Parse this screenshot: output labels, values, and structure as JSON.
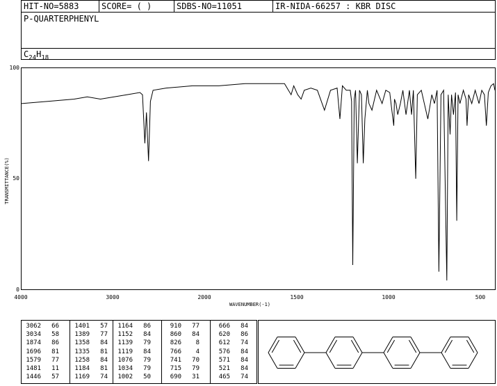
{
  "header": {
    "hit_no": "HIT-NO=5883",
    "score": "SCORE=  (  )",
    "sdbs_no": "SDBS-NO=11051",
    "ir_info": "IR-NIDA-66257 : KBR DISC",
    "compound": "P-QUARTERPHENYL",
    "formula_c": "C",
    "formula_c_n": "24",
    "formula_h": "H",
    "formula_h_n": "18"
  },
  "chart_data": {
    "type": "line",
    "xlabel": "WAVENUMBER(-1)",
    "ylabel": "TRANSMITTANCE(%)",
    "xlim": [
      4000,
      400
    ],
    "ylim": [
      0,
      100
    ],
    "x_ticks": [
      "4000",
      "3000",
      "2000",
      "1500",
      "1000",
      "500"
    ],
    "y_ticks": [
      "100",
      "50",
      "0"
    ],
    "grid": false,
    "series": [
      {
        "x": [
          4000,
          3800,
          3600,
          3500,
          3400,
          3200,
          3100,
          3080,
          3062,
          3050,
          3034,
          3020,
          3000,
          2900,
          2700,
          2500,
          2300,
          2100,
          2000,
          1950,
          1930,
          1900,
          1874,
          1850,
          1800,
          1750,
          1696,
          1650,
          1600,
          1579,
          1560,
          1530,
          1500,
          1490,
          1481,
          1470,
          1460,
          1446,
          1430,
          1415,
          1401,
          1389,
          1370,
          1358,
          1335,
          1300,
          1258,
          1230,
          1200,
          1184,
          1169,
          1164,
          1152,
          1139,
          1119,
          1100,
          1076,
          1050,
          1034,
          1020,
          1002,
          990,
          960,
          910,
          880,
          860,
          840,
          826,
          810,
          790,
          766,
          755,
          741,
          730,
          715,
          700,
          690,
          680,
          666,
          640,
          620,
          612,
          600,
          576,
          550,
          521,
          500,
          480,
          465,
          450,
          430,
          410,
          400
        ],
        "y": [
          84,
          85,
          86,
          87,
          86,
          88,
          89,
          88,
          66,
          80,
          58,
          85,
          90,
          91,
          92,
          92,
          93,
          93,
          93,
          88,
          92,
          88,
          86,
          90,
          91,
          90,
          81,
          90,
          91,
          77,
          92,
          90,
          90,
          85,
          11,
          86,
          90,
          57,
          90,
          88,
          57,
          77,
          90,
          84,
          81,
          90,
          84,
          90,
          89,
          81,
          74,
          86,
          84,
          79,
          84,
          90,
          79,
          90,
          79,
          90,
          50,
          88,
          90,
          77,
          88,
          84,
          90,
          8,
          88,
          90,
          4,
          88,
          70,
          88,
          79,
          89,
          31,
          88,
          84,
          90,
          86,
          74,
          88,
          84,
          90,
          84,
          90,
          88,
          74,
          89,
          92,
          93,
          90
        ]
      }
    ]
  },
  "peaks": [
    [
      [
        "3062",
        "66"
      ],
      [
        "3034",
        "58"
      ],
      [
        "1874",
        "86"
      ],
      [
        "1696",
        "81"
      ],
      [
        "1579",
        "77"
      ],
      [
        "1481",
        "11"
      ],
      [
        "1446",
        "57"
      ]
    ],
    [
      [
        "1401",
        "57"
      ],
      [
        "1389",
        "77"
      ],
      [
        "1358",
        "84"
      ],
      [
        "1335",
        "81"
      ],
      [
        "1258",
        "84"
      ],
      [
        "1184",
        "81"
      ],
      [
        "1169",
        "74"
      ]
    ],
    [
      [
        "1164",
        "86"
      ],
      [
        "1152",
        "84"
      ],
      [
        "1139",
        "79"
      ],
      [
        "1119",
        "84"
      ],
      [
        "1076",
        "79"
      ],
      [
        "1034",
        "79"
      ],
      [
        "1002",
        "50"
      ]
    ],
    [
      [
        "910",
        "77"
      ],
      [
        "860",
        "84"
      ],
      [
        "826",
        "8"
      ],
      [
        "766",
        "4"
      ],
      [
        "741",
        "70"
      ],
      [
        "715",
        "79"
      ],
      [
        "690",
        "31"
      ]
    ],
    [
      [
        "666",
        "84"
      ],
      [
        "620",
        "86"
      ],
      [
        "612",
        "74"
      ],
      [
        "576",
        "84"
      ],
      [
        "571",
        "84"
      ],
      [
        "521",
        "84"
      ],
      [
        "465",
        "74"
      ]
    ]
  ]
}
